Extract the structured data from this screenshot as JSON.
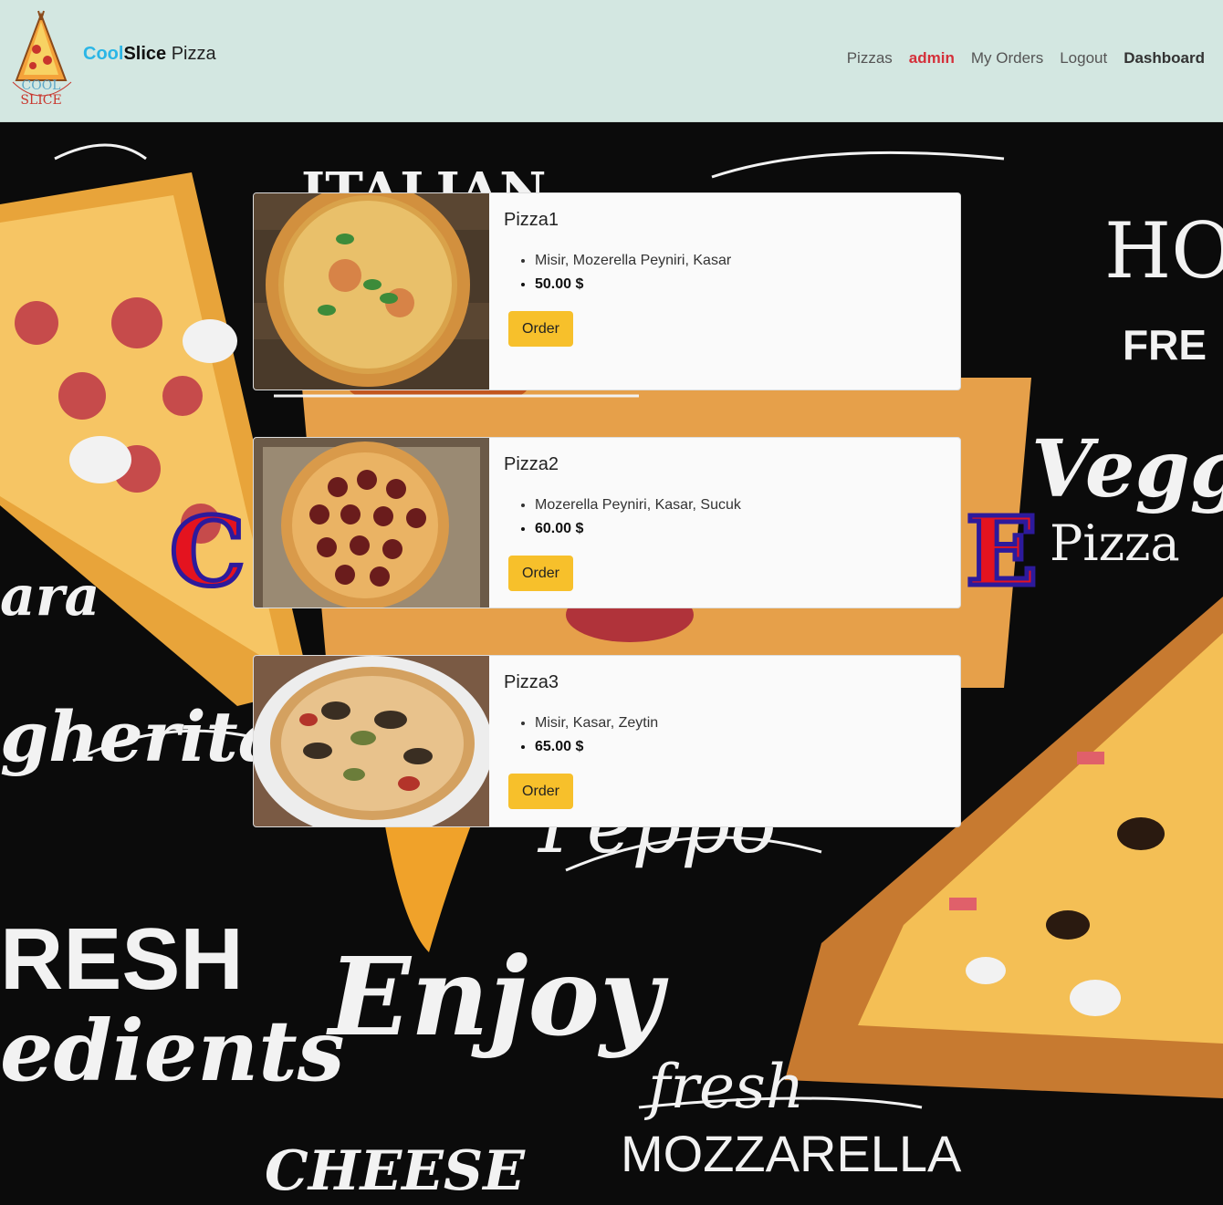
{
  "brand": {
    "cool": "Cool",
    "slice": "Slice",
    "pizza": " Pizza",
    "logo_text": "COOL SLICE"
  },
  "nav": {
    "pizzas": "Pizzas",
    "admin": "admin",
    "my_orders": "My Orders",
    "logout": "Logout",
    "dashboard": "Dashboard"
  },
  "background": {
    "words": [
      "ITALIAN",
      "HOT AND FRESH",
      "Veggie Pizza",
      "Margherita",
      "FRESH ingredients",
      "Enjoy",
      "Pepperoni",
      "fresh MOZZARELLA",
      "CHEESE"
    ]
  },
  "overlay_letters": {
    "left": "C",
    "right": "E"
  },
  "pizzas": [
    {
      "name": "Pizza1",
      "ingredients": "Misir, Mozerella Peyniri, Kasar",
      "price": "50.00 $",
      "button": "Order"
    },
    {
      "name": "Pizza2",
      "ingredients": "Mozerella Peyniri, Kasar, Sucuk",
      "price": "60.00 $",
      "button": "Order"
    },
    {
      "name": "Pizza3",
      "ingredients": "Misir, Kasar, Zeytin",
      "price": "65.00 $",
      "button": "Order"
    }
  ],
  "colors": {
    "navbar_bg": "#d3e7e1",
    "brand_accent": "#2bb6e6",
    "admin_red": "#d4303a",
    "order_button": "#f7c02b"
  }
}
